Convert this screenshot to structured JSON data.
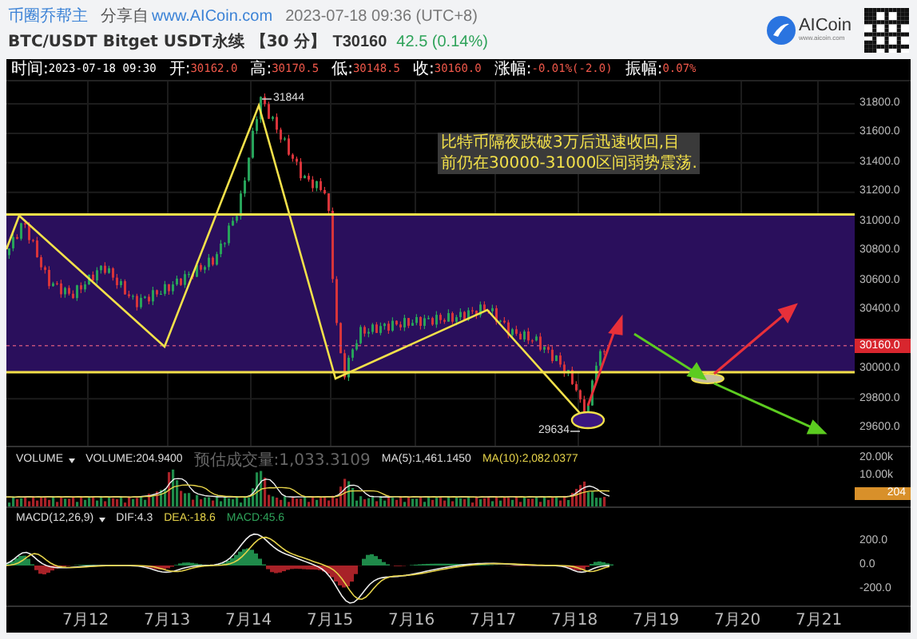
{
  "header": {
    "author": "币圈乔帮主",
    "share_label": "分享自",
    "share_link": "www.AICoin.com",
    "datetime": "2023-07-18 09:36 (UTC+8)",
    "symbol": "BTC/USDT Bitget USDT永续",
    "interval": "【30 分】",
    "price": "T30160",
    "change": "42.5 (0.14%)",
    "brand": "AICoin",
    "brand_url": "www.aicoin.com"
  },
  "ohlc_bar": [
    {
      "label": "时间:",
      "value": "2023-07-18 09:30",
      "color": "#ffffff"
    },
    {
      "label": "开:",
      "value": "30162.0",
      "color": "#f0584a"
    },
    {
      "label": "高:",
      "value": "30170.5",
      "color": "#f0584a"
    },
    {
      "label": "低:",
      "value": "30148.5",
      "color": "#f0584a"
    },
    {
      "label": "收:",
      "value": "30160.0",
      "color": "#f0584a"
    },
    {
      "label": "涨幅:",
      "value": "-0.01%(-2.0)",
      "color": "#f0584a"
    },
    {
      "label": "振幅:",
      "value": "0.07%",
      "color": "#f0584a"
    }
  ],
  "main_chart": {
    "price_axis": [
      "31800.0",
      "31600.0",
      "31400.0",
      "31200.0",
      "31000.0",
      "30800.0",
      "30600.0",
      "30400.0",
      "30000.0",
      "29800.0",
      "29600.0"
    ],
    "current_price": "30160.0",
    "high_label": "31844",
    "low_label": "29634",
    "note_lines": [
      "比特币隔夜跌破3万后迅速收回,目",
      "前仍在30000-31000区间弱势震荡."
    ]
  },
  "volume_panel": {
    "selector": "VOLUME",
    "reading": "VOLUME:204.9400",
    "estimate": "预估成交量:1,033.3109",
    "ma5": "MA(5):1,461.1450",
    "ma10": "MA(10):2,082.0377",
    "axis": [
      "20.00k",
      "10.00k"
    ],
    "current": "204"
  },
  "macd_panel": {
    "selector": "MACD(12,26,9)",
    "dif": "DIF:4.3",
    "dea": "DEA:-18.6",
    "macd": "MACD:45.6",
    "axis": [
      "200.0",
      "0.0",
      "-200.0"
    ]
  },
  "dates": [
    "7月12",
    "7月13",
    "7月14",
    "7月15",
    "7月16",
    "7月17",
    "7月18",
    "7月19",
    "7月20",
    "7月21"
  ]
}
